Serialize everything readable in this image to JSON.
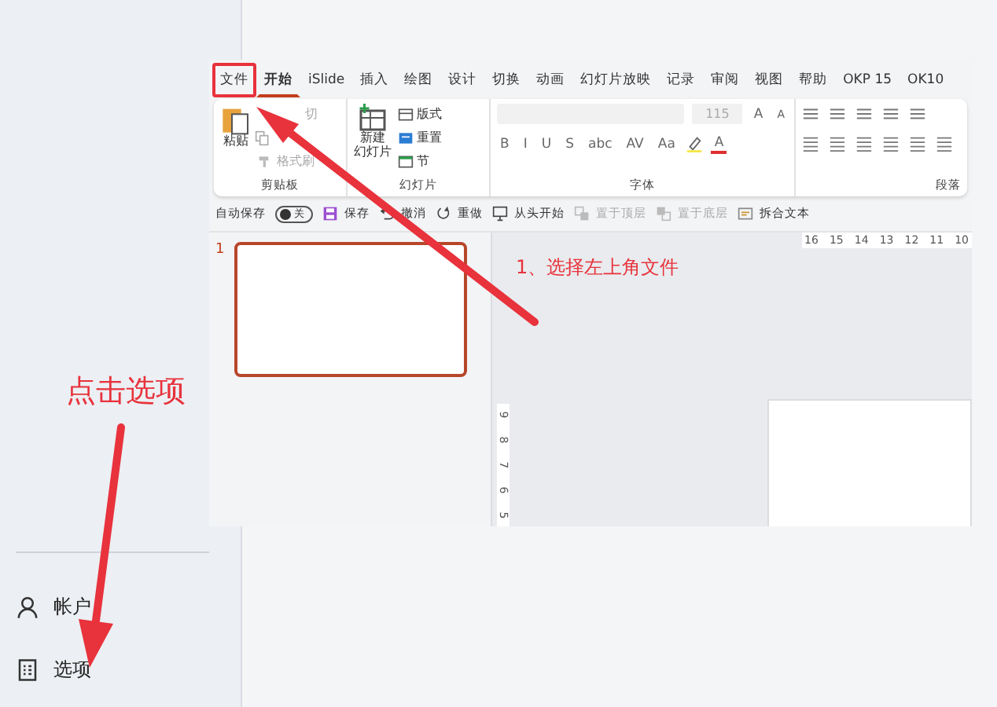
{
  "backstage": {
    "items": [
      {
        "kind": "account",
        "label": "帐户"
      },
      {
        "kind": "options",
        "label": "选项"
      }
    ]
  },
  "ribbon_tabs": [
    {
      "label": "文件",
      "selected": false,
      "highlighted": true
    },
    {
      "label": "开始",
      "selected": true,
      "highlighted": false
    },
    {
      "label": "iSlide",
      "selected": false,
      "highlighted": false
    },
    {
      "label": "插入",
      "selected": false,
      "highlighted": false
    },
    {
      "label": "绘图",
      "selected": false,
      "highlighted": false
    },
    {
      "label": "设计",
      "selected": false,
      "highlighted": false
    },
    {
      "label": "切换",
      "selected": false,
      "highlighted": false
    },
    {
      "label": "动画",
      "selected": false,
      "highlighted": false
    },
    {
      "label": "幻灯片放映",
      "selected": false,
      "highlighted": false
    },
    {
      "label": "记录",
      "selected": false,
      "highlighted": false
    },
    {
      "label": "审阅",
      "selected": false,
      "highlighted": false
    },
    {
      "label": "视图",
      "selected": false,
      "highlighted": false
    },
    {
      "label": "帮助",
      "selected": false,
      "highlighted": false
    },
    {
      "label": "OKP 15",
      "selected": false,
      "highlighted": false
    },
    {
      "label": "OK10",
      "selected": false,
      "highlighted": false
    }
  ],
  "clipboard": {
    "paste": "粘贴",
    "cut": {
      "label": "切",
      "disabled": true
    },
    "copy": {
      "disabled": true
    },
    "format_painter": {
      "label": "格式刷",
      "disabled": true
    },
    "group_label": "剪贴板"
  },
  "slides_group": {
    "new_slide": [
      "新建",
      "幻灯片"
    ],
    "layout": "版式",
    "reset": "重置",
    "section": "节",
    "group_label": "幻灯片"
  },
  "font_group": {
    "font_size": "115",
    "grow": "A",
    "shrink": "A",
    "styles": [
      "B",
      "I",
      "U",
      "S",
      "abc",
      "AV",
      "Aa"
    ],
    "font_color": "A",
    "group_label": "字体"
  },
  "paragraph_group": {
    "group_label": "段落"
  },
  "quick_access": {
    "autosave": {
      "label": "自动保存",
      "on": false,
      "state_text": "关"
    },
    "items": [
      {
        "kind": "save",
        "label": "保存",
        "disabled": false
      },
      {
        "kind": "undo",
        "label": "撤消",
        "disabled": false
      },
      {
        "kind": "redo",
        "label": "重做",
        "disabled": false
      },
      {
        "kind": "slideshow",
        "label": "从头开始",
        "disabled": false
      },
      {
        "kind": "front",
        "label": "置于顶层",
        "disabled": true
      },
      {
        "kind": "back",
        "label": "置于底层",
        "disabled": true
      },
      {
        "kind": "text",
        "label": "拆合文本",
        "disabled": false
      }
    ]
  },
  "thumbnails": [
    {
      "number": "1",
      "selected": true
    }
  ],
  "ruler": {
    "horizontal": [
      "16",
      "15",
      "14",
      "13",
      "12",
      "11",
      "10"
    ],
    "vertical": [
      "9",
      "8",
      "7",
      "6",
      "5"
    ]
  },
  "annotations": [
    {
      "kind": "step",
      "text": "1、选择左上角文件"
    },
    {
      "kind": "hint",
      "text": "点击选项"
    }
  ]
}
